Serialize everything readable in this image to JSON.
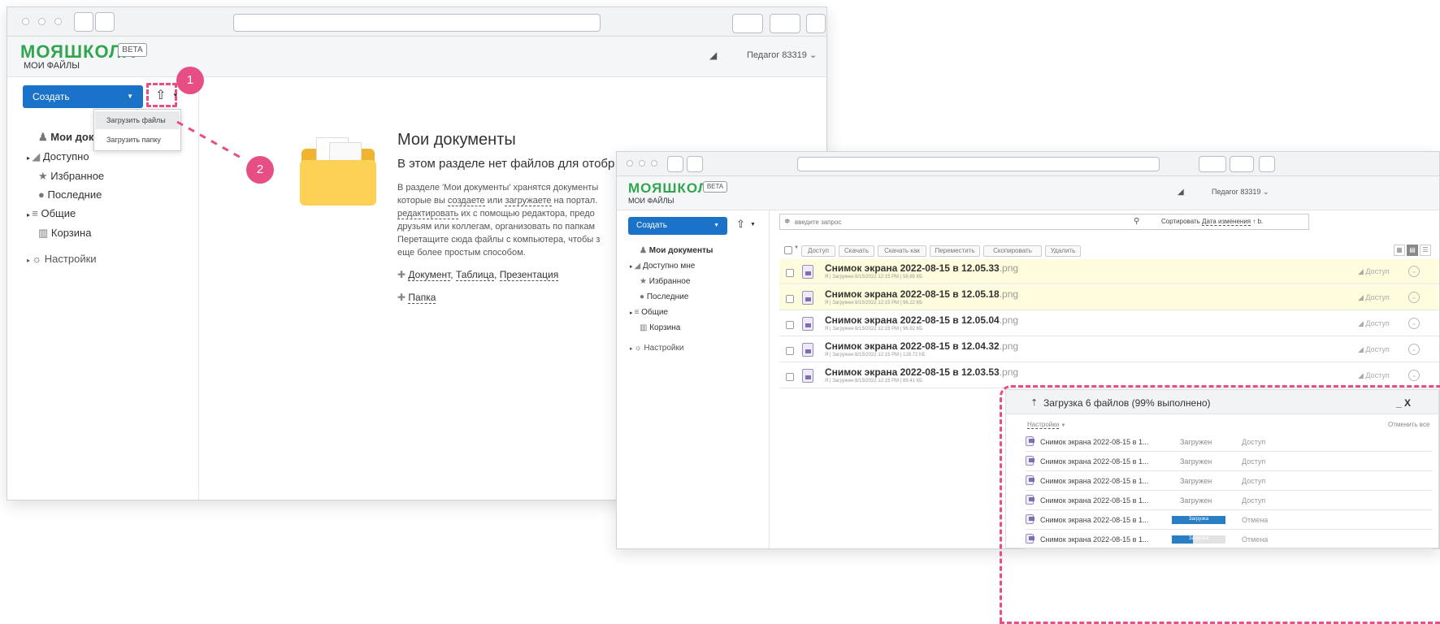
{
  "app": {
    "logo": "МОЯШКОЛА",
    "beta": "BETA",
    "subtitle": "МОИ ФАЙЛЫ",
    "user": "Педагог 83319"
  },
  "toolbar": {
    "create": "Создать"
  },
  "upload_menu": {
    "upload_files": "Загрузить файлы",
    "upload_folder": "Загрузить папку"
  },
  "sidebar": {
    "my_documents": "Мои документы",
    "shared_with_me": "Доступно мне",
    "favorites": "Избранное",
    "recent": "Последние",
    "common": "Общие",
    "trash": "Корзина",
    "settings": "Настройки"
  },
  "left_nav": {
    "my_documents": "Мои доку",
    "shared_with_me": "Доступно"
  },
  "empty": {
    "title": "Мои документы",
    "subtitle": "В этом разделе нет файлов для отобр",
    "line1a": "В разделе 'Мои документы' хранятся документы",
    "line2a": "которые вы ",
    "line2b": "создаете",
    "line2c": " или ",
    "line2d": "загружаете",
    "line2e": " на портал.",
    "line3a": "редактировать",
    "line3b": " их с помощью редактора, предо",
    "line4": "друзьям или коллегам, организовать по папкам",
    "line5": "Перетащите сюда файлы с компьютера, чтобы з",
    "line6": "еще более простым способом.",
    "create_doc": "Документ",
    "create_table": "Таблица",
    "create_pres": "Презентация",
    "create_folder": "Папка",
    "sep": ", "
  },
  "badges": {
    "one": "1",
    "two": "2"
  },
  "search": {
    "placeholder": "введите запрос",
    "sort_label": "Сортировать",
    "sort_value": "Дата изменения",
    "sort_dir": "↑ b."
  },
  "actions": {
    "access": "Доступ",
    "download": "Скачать",
    "download_as": "Скачать как",
    "move": "Переместить",
    "copy": "Скопировать",
    "delete": "Удалить"
  },
  "files": [
    {
      "name": "Снимок экрана 2022-08-15 в 12.05.33",
      "ext": ".png",
      "meta": "Я | Загружен 8/15/2022 12:15 PM | 58.65 КБ",
      "access": "Доступ"
    },
    {
      "name": "Снимок экрана 2022-08-15 в 12.05.18",
      "ext": ".png",
      "meta": "Я | Загружен 8/15/2022 12:15 PM | 96.22 КБ",
      "access": "Доступ"
    },
    {
      "name": "Снимок экрана 2022-08-15 в 12.05.04",
      "ext": ".png",
      "meta": "Я | Загружен 8/15/2022 12:15 PM | 96.92 КБ",
      "access": "Доступ"
    },
    {
      "name": "Снимок экрана 2022-08-15 в 12.04.32",
      "ext": ".png",
      "meta": "Я | Загружен 8/15/2022 12:15 PM | 128.72 КБ",
      "access": "Доступ"
    },
    {
      "name": "Снимок экрана 2022-08-15 в 12.03.53",
      "ext": ".png",
      "meta": "Я | Загружен 8/15/2022 12:15 PM | 89.41 КБ",
      "access": "Доступ"
    }
  ],
  "upload_panel": {
    "title": "Загрузка 6 файлов (99% выполнено)",
    "close": "_ X",
    "settings": "Настройки",
    "cancel_all": "Отменить все",
    "items": [
      {
        "name": "Снимок экрана 2022-08-15 в 1...",
        "status": "Загружен",
        "action": "Доступ",
        "progress": null
      },
      {
        "name": "Снимок экрана 2022-08-15 в 1...",
        "status": "Загружен",
        "action": "Доступ",
        "progress": null
      },
      {
        "name": "Снимок экрана 2022-08-15 в 1...",
        "status": "Загружен",
        "action": "Доступ",
        "progress": null
      },
      {
        "name": "Снимок экрана 2022-08-15 в 1...",
        "status": "Загружен",
        "action": "Доступ",
        "progress": null
      },
      {
        "name": "Снимок экрана 2022-08-15 в 1...",
        "status": "Загрузка",
        "action": "Отмена",
        "progress": 1.0
      },
      {
        "name": "Снимок экрана 2022-08-15 в 1...",
        "status": "Загрузка",
        "action": "Отмена",
        "progress": 0.4
      }
    ]
  },
  "colors": {
    "brand": "#2fa64f",
    "primary": "#1a73c9",
    "accent": "#e74e84"
  }
}
